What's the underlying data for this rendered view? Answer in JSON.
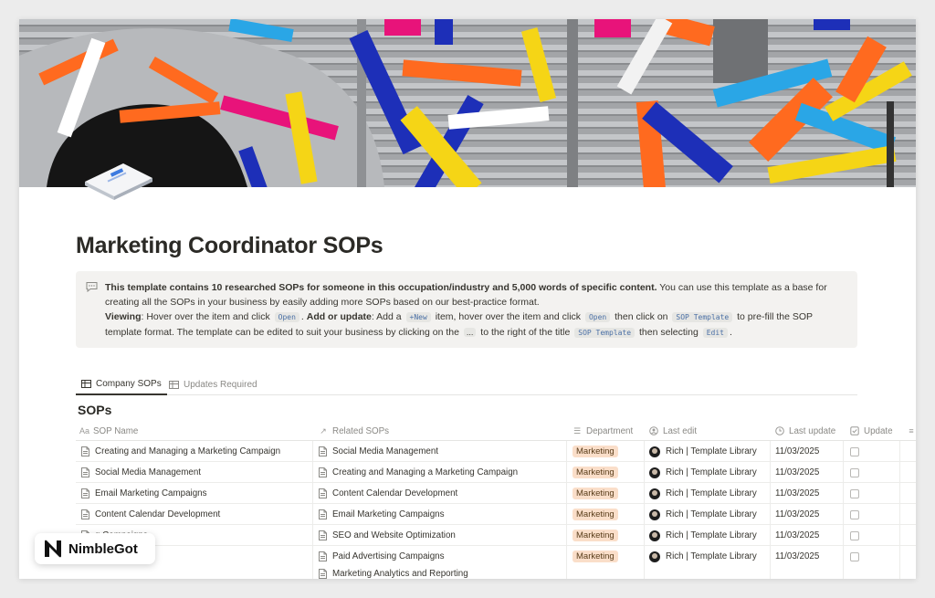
{
  "brand": {
    "name": "NimbleGot"
  },
  "page": {
    "title": "Marketing Coordinator SOPs",
    "cover_icon": "stacked-papers-icon"
  },
  "callout": {
    "icon": "speech-bubble-icon",
    "line1_bold": "This template contains 10 researched SOPs for someone in this occupation/industry and 5,000 words of specific content.",
    "line1_rest": " You can use this template as a base for creating all the SOPs in your business by easily adding more SOPs based on our best-practice format.",
    "viewing_label": "Viewing",
    "viewing_text_a": ": Hover over the item and click ",
    "open_code": "Open",
    "viewing_text_b": ". ",
    "add_label": "Add or update",
    "add_text_a": ": Add a ",
    "new_code": "+New",
    "add_text_b": " item, hover over the item and click ",
    "open_code_2": "Open",
    "add_text_c": " then click on ",
    "sop_template_code": "SOP Template",
    "add_text_d": " to pre-fill the SOP template format. The template can be edited to suit your business by clicking on the ",
    "ellipsis": "...",
    "add_text_e": " to the right of the title ",
    "sop_template_code_2": "SOP Template",
    "add_text_f": " then selecting ",
    "edit_code": "Edit",
    "add_text_g": "."
  },
  "tabs": [
    {
      "label": "Company SOPs",
      "active": true
    },
    {
      "label": "Updates Required",
      "active": false
    }
  ],
  "database": {
    "title": "SOPs",
    "columns": [
      {
        "icon": "Aa",
        "label": "SOP Name"
      },
      {
        "icon": "↗",
        "label": "Related SOPs"
      },
      {
        "icon": "☰",
        "label": "Department"
      },
      {
        "icon": "person-icon",
        "label": "Last edit"
      },
      {
        "icon": "clock-icon",
        "label": "Last update"
      },
      {
        "icon": "checkbox-icon",
        "label": "Update"
      }
    ],
    "rows": [
      {
        "name": "Creating and Managing a Marketing Campaign",
        "related": [
          "Social Media Management"
        ],
        "department": "Marketing",
        "last_edit": "Rich | Template Library",
        "last_update": "11/03/2025",
        "update": false
      },
      {
        "name": "Social Media Management",
        "related": [
          "Creating and Managing a Marketing Campaign"
        ],
        "department": "Marketing",
        "last_edit": "Rich | Template Library",
        "last_update": "11/03/2025",
        "update": false
      },
      {
        "name": "Email Marketing Campaigns",
        "related": [
          "Content Calendar Development"
        ],
        "department": "Marketing",
        "last_edit": "Rich | Template Library",
        "last_update": "11/03/2025",
        "update": false
      },
      {
        "name": "Content Calendar Development",
        "related": [
          "Email Marketing Campaigns"
        ],
        "department": "Marketing",
        "last_edit": "Rich | Template Library",
        "last_update": "11/03/2025",
        "update": false
      },
      {
        "name": "g Campaigns",
        "related": [
          "SEO and Website Optimization"
        ],
        "department": "Marketing",
        "last_edit": "Rich | Template Library",
        "last_update": "11/03/2025",
        "update": false
      },
      {
        "name": "te Optimization",
        "related": [
          "Paid Advertising Campaigns",
          "Marketing Analytics and Reporting"
        ],
        "department": "Marketing",
        "last_edit": "Rich | Template Library",
        "last_update": "11/03/2025",
        "update": false
      }
    ]
  },
  "colors": {
    "tag_bg": "#fadec9",
    "accent_code": "#4a6fa5"
  }
}
